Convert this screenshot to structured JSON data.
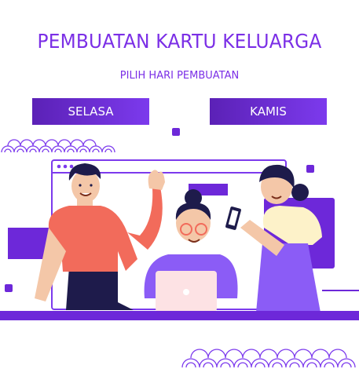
{
  "page": {
    "title": "PEMBUATAN KARTU KELUARGA",
    "subtitle": "PILIH HARI PEMBUATAN"
  },
  "buttons": {
    "selasa": "SELASA",
    "kamis": "KAMIS"
  },
  "colors": {
    "accent": "#7b2fe6",
    "button": "#6d28d9"
  }
}
